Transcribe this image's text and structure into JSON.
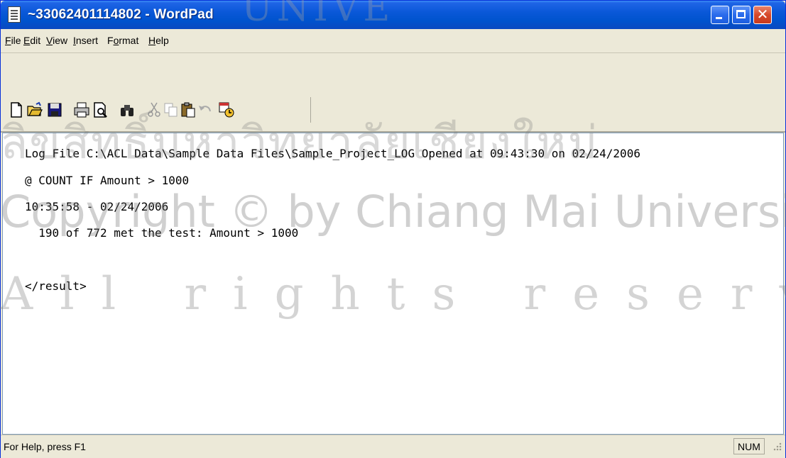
{
  "window": {
    "title": "~33062401114802 - WordPad",
    "icon": "document-icon"
  },
  "menu": {
    "items": [
      {
        "label": "File",
        "accel": "F",
        "rest": "ile"
      },
      {
        "label": "Edit",
        "accel": "E",
        "rest": "dit"
      },
      {
        "label": "View",
        "accel": "V",
        "rest": "iew"
      },
      {
        "label": "Insert",
        "accel": "I",
        "rest": "nsert"
      },
      {
        "label": "Format",
        "pre": "F",
        "accel": "o",
        "rest": "rmat"
      },
      {
        "label": "Help",
        "accel": "H",
        "rest": "elp"
      }
    ]
  },
  "toolbar": {
    "icons": [
      "new-icon",
      "open-icon",
      "save-icon",
      "print-icon",
      "print-preview-icon",
      "find-icon",
      "cut-icon",
      "copy-icon",
      "paste-icon",
      "undo-icon",
      "insert-datetime-icon"
    ]
  },
  "document": {
    "lines": [
      "Log File C:\\ACL Data\\Sample Data Files\\Sample_Project_LOG Opened at 09:43:30 on 02/24/2006",
      "@ COUNT IF Amount > 1000",
      "10:35:58 - 02/24/2006",
      "  190 of 772 met the test: Amount > 1000",
      "",
      "</result>"
    ]
  },
  "status": {
    "help_text": "For Help, press F1",
    "num_indicator": "NUM"
  },
  "watermark": {
    "top": "UNIVE",
    "thai": "ลิขสิทธิ์มหาวิทยาลัยเชียงใหม่",
    "copyright": "Copyright © by Chiang Mai University",
    "rights": "All rights reserved"
  },
  "colors": {
    "titlebar": "#0a58d8",
    "chrome": "#ece9d8",
    "close_button": "#d6492a"
  }
}
